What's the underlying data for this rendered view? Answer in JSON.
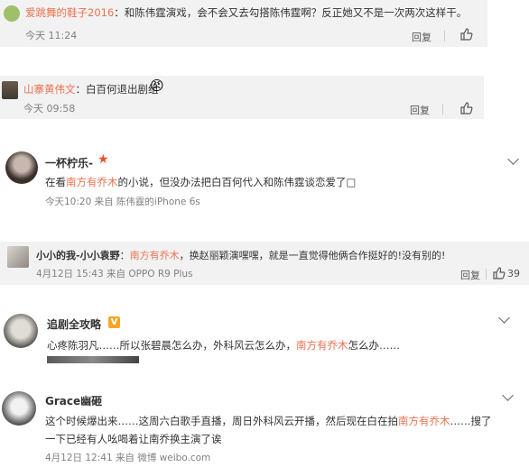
{
  "comments": [
    {
      "user": "爱跳舞的鞋子2016",
      "text": "：和陈伟霆演戏，会不会又去勾搭陈伟霆啊？反正她又不是一次两次这样干。",
      "time": "今天 11:24",
      "reply": "回复"
    },
    {
      "user": "山寨黄伟文",
      "text": "：白百何退出剧组",
      "emoji": "😠",
      "time": "今天 09:58",
      "reply": "回复"
    },
    {
      "user": "一杯柠乐-",
      "text_pre": "在看",
      "link": "南方有乔木",
      "text_post": "的小说，但没办法把白百何代入和陈伟霆谈恋爱了□",
      "time": "今天10:20 来自 陈伟霆的iPhone 6s"
    },
    {
      "user": "小小的我-小小袁野",
      "text_pre": "：",
      "link": "南方有乔木",
      "text_post": "，换赵丽颖演嘿嘿，就是一直觉得他俩合作挺好的!没有别的!",
      "time": "4月12日 15:43 来自 OPPO R9 Plus",
      "reply": "回复",
      "likes": "39"
    },
    {
      "user": "追剧全攻略",
      "badge": "V",
      "text_pre": "心疼陈羽凡……所以张碧晨怎么办，外科风云怎么办，",
      "link": "南方有乔木",
      "text_post": "怎么办……"
    },
    {
      "user": "Grace幽砸",
      "text_pre": "这个时候爆出来……这周六白歌手直播，周日外科风云开播，然后现在白在拍",
      "link": "南方有乔木",
      "text_post": "……搜了",
      "text_line2": "一下已经有人吆喝着让南乔换主演了诶",
      "time": "4月12日 12:41 来自 微博 weibo.com"
    }
  ],
  "colors": {
    "accent": "#eb7350",
    "card_bg": "#f2f2f2",
    "text": "#333333",
    "meta": "#808080"
  }
}
